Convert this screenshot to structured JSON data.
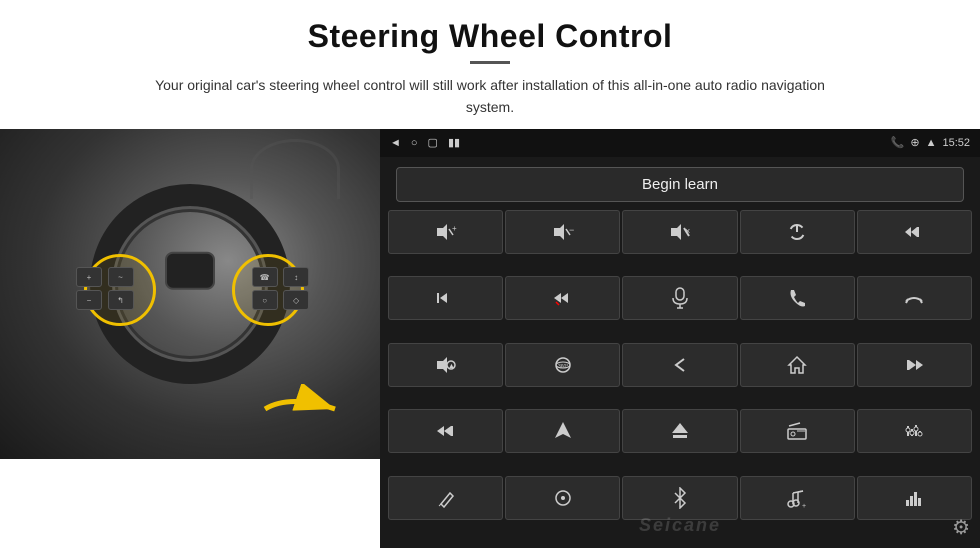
{
  "page": {
    "title": "Steering Wheel Control",
    "divider": true,
    "subtitle": "Your original car's steering wheel control will still work after installation of this all-in-one auto radio navigation system."
  },
  "status_bar": {
    "time": "15:52",
    "icons": [
      "◄",
      "□",
      "▢"
    ]
  },
  "begin_learn": {
    "label": "Begin learn"
  },
  "controls": [
    [
      "🔊+",
      "🔊-",
      "🔇",
      "⏻",
      "⏮"
    ],
    [
      "⏭",
      "⏭⏭",
      "🎤",
      "📞",
      "↩"
    ],
    [
      "📢",
      "⚙️",
      "↩",
      "🏠",
      "⏮⏮"
    ],
    [
      "⏭",
      "▶",
      "⏏",
      "📻",
      "🎚"
    ],
    [
      "✏️",
      "⊙",
      "✱",
      "🎵",
      "📊"
    ]
  ],
  "controls_icons": [
    {
      "id": "vol-up",
      "symbol": "◀+",
      "label": "Volume Up"
    },
    {
      "id": "vol-down",
      "symbol": "◀-",
      "label": "Volume Down"
    },
    {
      "id": "mute",
      "symbol": "◀×",
      "label": "Mute"
    },
    {
      "id": "power",
      "symbol": "⏻",
      "label": "Power"
    },
    {
      "id": "prev-track",
      "symbol": "⏮",
      "label": "Previous Track"
    },
    {
      "id": "next-track",
      "symbol": "⏭",
      "label": "Next Track"
    },
    {
      "id": "fast-forward",
      "symbol": "⏩",
      "label": "Fast Forward"
    },
    {
      "id": "mic",
      "symbol": "🎤",
      "label": "Microphone"
    },
    {
      "id": "phone",
      "symbol": "📞",
      "label": "Phone"
    },
    {
      "id": "hang-up",
      "symbol": "↩",
      "label": "Hang Up"
    },
    {
      "id": "horn",
      "symbol": "📢",
      "label": "Horn"
    },
    {
      "id": "360",
      "symbol": "360",
      "label": "360 View"
    },
    {
      "id": "back",
      "symbol": "↩",
      "label": "Back"
    },
    {
      "id": "home",
      "symbol": "⌂",
      "label": "Home"
    },
    {
      "id": "prev2",
      "symbol": "⏮⏮",
      "label": "Previous"
    },
    {
      "id": "next2",
      "symbol": "⏭",
      "label": "Next"
    },
    {
      "id": "nav",
      "symbol": "▲",
      "label": "Navigation"
    },
    {
      "id": "eject",
      "symbol": "⏏",
      "label": "Eject"
    },
    {
      "id": "radio",
      "symbol": "📻",
      "label": "Radio"
    },
    {
      "id": "eq",
      "symbol": "⚌",
      "label": "Equalizer"
    },
    {
      "id": "pen",
      "symbol": "✎",
      "label": "Pen"
    },
    {
      "id": "circle",
      "symbol": "⊙",
      "label": "Circle"
    },
    {
      "id": "bluetooth",
      "symbol": "✱",
      "label": "Bluetooth"
    },
    {
      "id": "music",
      "symbol": "♫",
      "label": "Music"
    },
    {
      "id": "bars",
      "symbol": "▐▌",
      "label": "Bars"
    }
  ],
  "watermark": {
    "text": "Seicane"
  },
  "gear_icon": {
    "symbol": "⚙"
  }
}
